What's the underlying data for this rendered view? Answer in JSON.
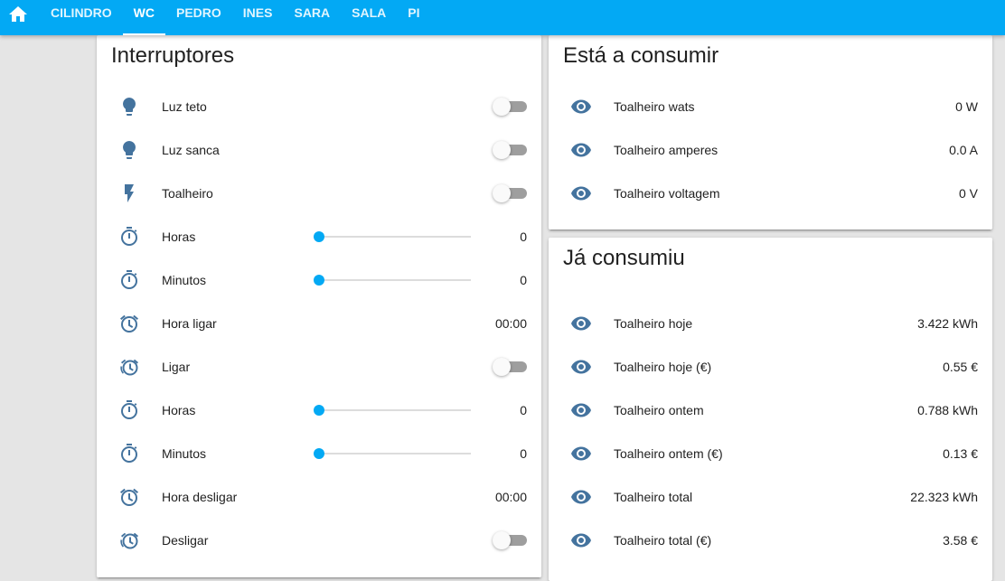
{
  "topbar": {
    "home_icon": "home-icon",
    "tabs": [
      {
        "label": "CILINDRO",
        "active": false
      },
      {
        "label": "WC",
        "active": true
      },
      {
        "label": "PEDRO",
        "active": false
      },
      {
        "label": "INES",
        "active": false
      },
      {
        "label": "SARA",
        "active": false
      },
      {
        "label": "SALA",
        "active": false
      },
      {
        "label": "PI",
        "active": false
      }
    ]
  },
  "colors": {
    "accent": "#03a9f4",
    "icon": "#44739e",
    "toggle_off_track": "#9e9e9e",
    "toggle_knob": "#fafafa"
  },
  "interruptores": {
    "title": "Interruptores",
    "rows": [
      {
        "icon": "lightbulb-icon",
        "label": "Luz teto",
        "control": "toggle",
        "state": "off"
      },
      {
        "icon": "lightbulb-icon",
        "label": "Luz sanca",
        "control": "toggle",
        "state": "off"
      },
      {
        "icon": "flash-icon",
        "label": "Toalheiro",
        "control": "toggle",
        "state": "off"
      },
      {
        "icon": "timer-icon",
        "label": "Horas",
        "control": "slider",
        "slider_fraction": 0,
        "value": "0"
      },
      {
        "icon": "timer-icon",
        "label": "Minutos",
        "control": "slider",
        "slider_fraction": 0,
        "value": "0"
      },
      {
        "icon": "alarm-icon",
        "label": "Hora ligar",
        "control": "text",
        "value": "00:00"
      },
      {
        "icon": "alarm-snooze-icon",
        "label": "Ligar",
        "control": "toggle",
        "state": "off"
      },
      {
        "icon": "timer-icon",
        "label": "Horas",
        "control": "slider",
        "slider_fraction": 0,
        "value": "0"
      },
      {
        "icon": "timer-icon",
        "label": "Minutos",
        "control": "slider",
        "slider_fraction": 0,
        "value": "0"
      },
      {
        "icon": "alarm-icon",
        "label": "Hora desligar",
        "control": "text",
        "value": "00:00"
      },
      {
        "icon": "alarm-snooze-icon",
        "label": "Desligar",
        "control": "toggle",
        "state": "off"
      }
    ]
  },
  "consumir": {
    "title": "Está a consumir",
    "rows": [
      {
        "icon": "eye-icon",
        "label": "Toalheiro wats",
        "value": "0 W"
      },
      {
        "icon": "eye-icon",
        "label": "Toalheiro amperes",
        "value": "0.0 A"
      },
      {
        "icon": "eye-icon",
        "label": "Toalheiro voltagem",
        "value": "0 V"
      }
    ]
  },
  "consumiu": {
    "title": "Já consumiu",
    "rows": [
      {
        "icon": "eye-icon",
        "label": "Toalheiro hoje",
        "value": "3.422 kWh"
      },
      {
        "icon": "eye-icon",
        "label": "Toalheiro hoje (€)",
        "value": "0.55 €"
      },
      {
        "icon": "eye-icon",
        "label": "Toalheiro ontem",
        "value": "0.788 kWh"
      },
      {
        "icon": "eye-icon",
        "label": "Toalheiro ontem (€)",
        "value": "0.13 €"
      },
      {
        "icon": "eye-icon",
        "label": "Toalheiro total",
        "value": "22.323 kWh"
      },
      {
        "icon": "eye-icon",
        "label": "Toalheiro total (€)",
        "value": "3.58 €"
      }
    ]
  }
}
